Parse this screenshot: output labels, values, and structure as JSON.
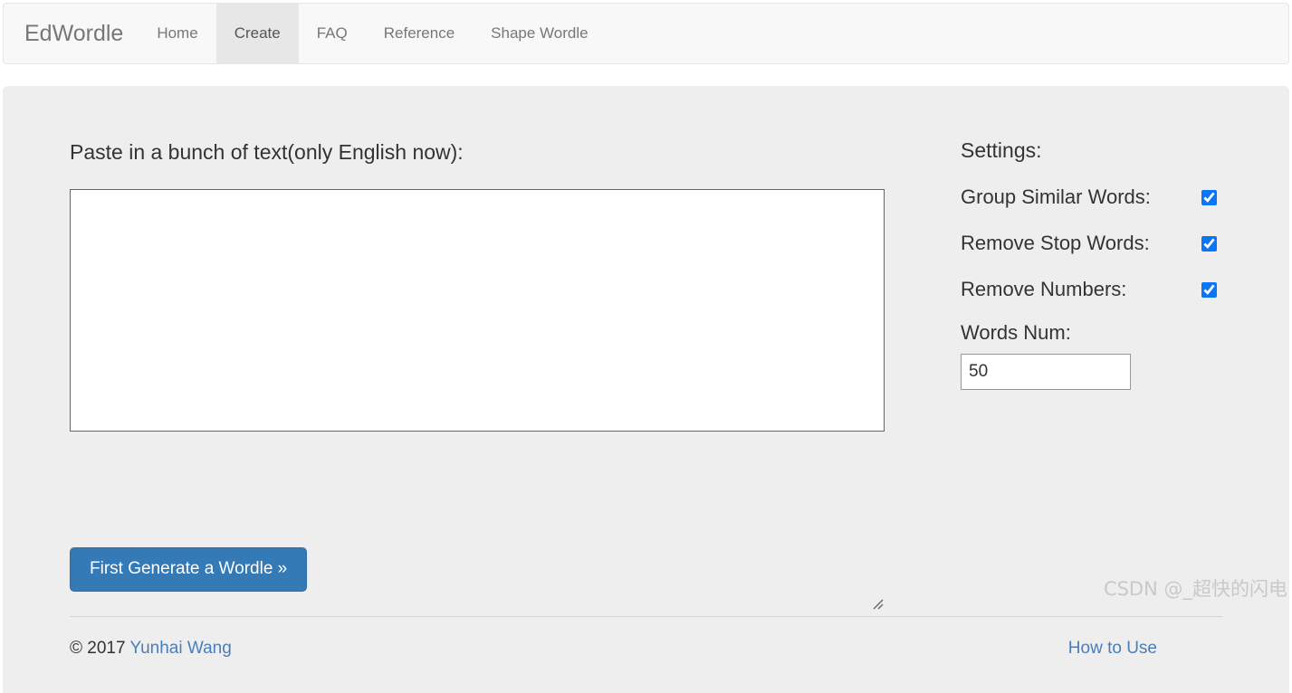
{
  "navbar": {
    "brand": "EdWordle",
    "items": [
      {
        "label": "Home",
        "active": false
      },
      {
        "label": "Create",
        "active": true
      },
      {
        "label": "FAQ",
        "active": false
      },
      {
        "label": "Reference",
        "active": false
      },
      {
        "label": "Shape Wordle",
        "active": false
      }
    ]
  },
  "main": {
    "page_title": "Paste in a bunch of text(only English now):",
    "textarea": {
      "value": "",
      "placeholder": ""
    },
    "generate_button": "First Generate a Wordle »"
  },
  "settings": {
    "title": "Settings:",
    "checkboxes": [
      {
        "label": "Group Similar Words:",
        "checked": true
      },
      {
        "label": "Remove Stop Words:",
        "checked": true
      },
      {
        "label": "Remove Numbers:",
        "checked": true
      }
    ],
    "words_num": {
      "label": "Words Num:",
      "value": "50"
    }
  },
  "footer": {
    "copyright_prefix": "© 2017 ",
    "author_link": "Yunhai Wang",
    "how_to_use": "How to Use",
    "watermark": "CSDN @_超快的闪电"
  },
  "colors": {
    "accent_blue": "#337ab7",
    "link_blue": "#4a7ebb",
    "checkbox_blue": "#0a76f6",
    "panel_gray": "#eeeeee",
    "navbar_gray": "#f8f8f8",
    "active_tab_gray": "#e7e7e7"
  }
}
